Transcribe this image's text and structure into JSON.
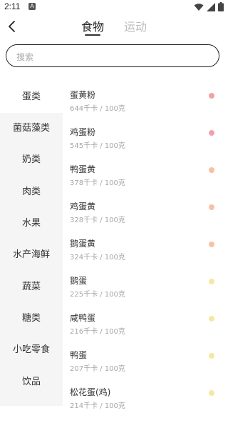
{
  "status_bar": {
    "time": "2:11",
    "notif_letter": "A"
  },
  "header": {
    "tabs": [
      {
        "label": "食物"
      },
      {
        "label": "运动"
      }
    ]
  },
  "search": {
    "placeholder": "搜索"
  },
  "categories": [
    {
      "label": "蛋类"
    },
    {
      "label": "菌菇藻类"
    },
    {
      "label": "奶类"
    },
    {
      "label": "肉类"
    },
    {
      "label": "水果"
    },
    {
      "label": "水产海鲜"
    },
    {
      "label": "蔬菜"
    },
    {
      "label": "糖类"
    },
    {
      "label": "小吃零食"
    },
    {
      "label": "饮品"
    }
  ],
  "foods": [
    {
      "name": "蛋黄粉",
      "calories": "644千卡 / 100克",
      "dot_color": "#f3a1a8"
    },
    {
      "name": "鸡蛋粉",
      "calories": "545千卡 / 100克",
      "dot_color": "#f3a1a8"
    },
    {
      "name": "鸭蛋黄",
      "calories": "378千卡 / 100克",
      "dot_color": "#f6c2a3"
    },
    {
      "name": "鸡蛋黄",
      "calories": "328千卡 / 100克",
      "dot_color": "#f6c2a3"
    },
    {
      "name": "鹅蛋黄",
      "calories": "324千卡 / 100克",
      "dot_color": "#f6c2a3"
    },
    {
      "name": "鹅蛋",
      "calories": "225千卡 / 100克",
      "dot_color": "#f8e6a6"
    },
    {
      "name": "咸鸭蛋",
      "calories": "216千卡 / 100克",
      "dot_color": "#f8e6a6"
    },
    {
      "name": "鸭蛋",
      "calories": "207千卡 / 100克",
      "dot_color": "#f8e6a6"
    },
    {
      "name": "松花蛋(鸡)",
      "calories": "214千卡 / 100克",
      "dot_color": "#f8e6a6"
    }
  ]
}
